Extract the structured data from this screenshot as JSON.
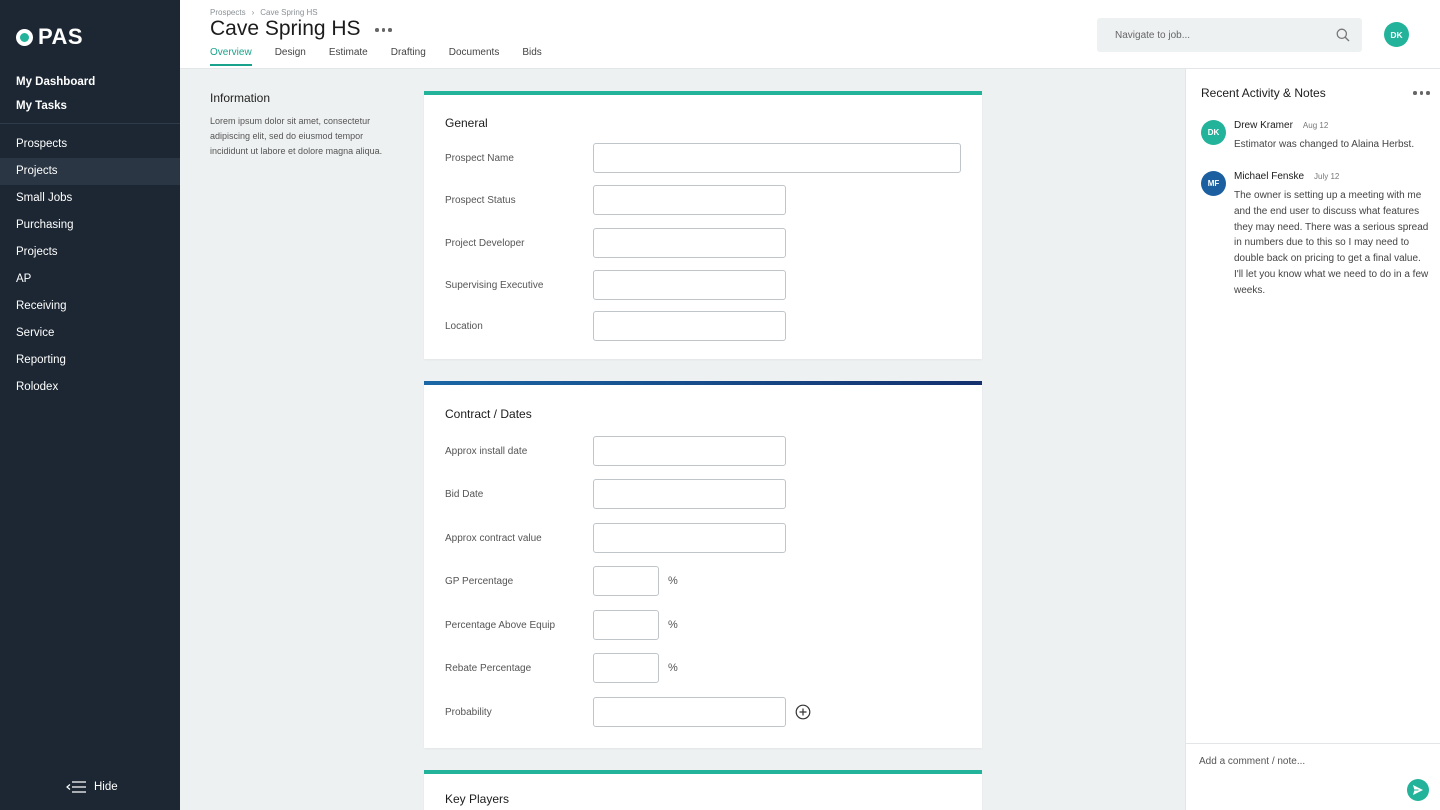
{
  "app": {
    "logo": "PAS"
  },
  "sidebar": {
    "top_items": [
      {
        "label": "My Dashboard"
      },
      {
        "label": "My Tasks"
      }
    ],
    "items": [
      {
        "label": "Prospects"
      },
      {
        "label": "Projects",
        "active": true
      },
      {
        "label": "Small Jobs"
      },
      {
        "label": "Purchasing"
      },
      {
        "label": "Projects"
      },
      {
        "label": "AP"
      },
      {
        "label": "Receiving"
      },
      {
        "label": "Service"
      },
      {
        "label": "Reporting"
      },
      {
        "label": "Rolodex"
      }
    ],
    "hide_label": "Hide"
  },
  "header": {
    "breadcrumb": {
      "parent": "Prospects",
      "separator": "›",
      "current": "Cave Spring HS"
    },
    "title": "Cave Spring HS",
    "tabs": [
      {
        "label": "Overview",
        "active": true
      },
      {
        "label": "Design"
      },
      {
        "label": "Estimate"
      },
      {
        "label": "Drafting"
      },
      {
        "label": "Documents"
      },
      {
        "label": "Bids"
      }
    ],
    "search": {
      "placeholder": "Navigate to job..."
    },
    "user_initials": "DK"
  },
  "info": {
    "title": "Information",
    "text": "Lorem ipsum dolor sit amet, consectetur adipiscing elit, sed do eiusmod tempor incididunt ut labore et dolore magna aliqua."
  },
  "general": {
    "title": "General",
    "fields": [
      {
        "label": "Prospect Name",
        "value": ""
      },
      {
        "label": "Prospect Status",
        "value": ""
      },
      {
        "label": "Project Developer",
        "value": ""
      },
      {
        "label": "Supervising Executive",
        "value": ""
      },
      {
        "label": "Location",
        "value": ""
      }
    ]
  },
  "contract": {
    "title": "Contract / Dates",
    "fields": [
      {
        "label": "Approx install date",
        "value": ""
      },
      {
        "label": "Bid Date",
        "value": ""
      },
      {
        "label": "Approx contract value",
        "value": ""
      },
      {
        "label": "GP Percentage",
        "value": "",
        "unit": "%"
      },
      {
        "label": "Percentage Above Equip",
        "value": "",
        "unit": "%"
      },
      {
        "label": "Rebate Percentage",
        "value": "",
        "unit": "%"
      },
      {
        "label": "Probability",
        "value": ""
      }
    ]
  },
  "key_players": {
    "title": "Key Players"
  },
  "activity": {
    "title": "Recent Activity & Notes",
    "notes": [
      {
        "initials": "DK",
        "name": "Drew Kramer",
        "date": "Aug 12",
        "body": "Estimator was changed to Alaina Herbst."
      },
      {
        "initials": "MF",
        "name": "Michael Fenske",
        "date": "July 12",
        "body": "The owner is setting up a meeting with me and the end user to discuss what features they may need. There was a serious spread in numbers due to this so I may need to double back on pricing to get a final value. I'll let you know what we need to do in a few weeks."
      }
    ],
    "comment_placeholder": "Add a comment / note..."
  },
  "colors": {
    "accent": "#22b39a",
    "sidebar": "#1c2733",
    "blue": "#1b5fa0"
  }
}
